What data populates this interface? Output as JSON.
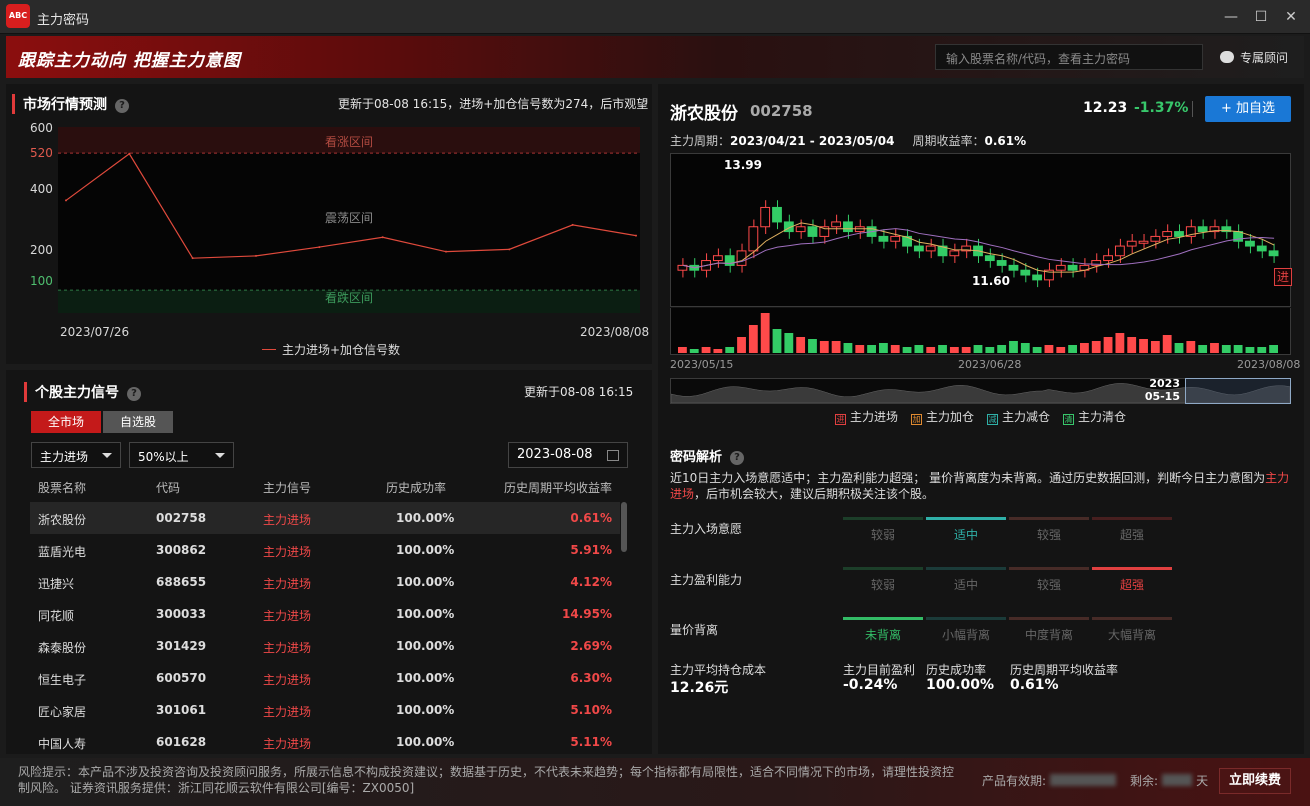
{
  "window": {
    "title": "主力密码",
    "logo_text": "ABC"
  },
  "banner": {
    "slogan": "跟踪主力动向  把握主力意图",
    "search_placeholder": "输入股票名称/代码，查看主力密码",
    "advisor_label": "专属顾问"
  },
  "market": {
    "title": "市场行情预测",
    "note": "更新于08-08 16:15，进场+加仓信号数为274，后市观望",
    "zones": {
      "bull": "看涨区间",
      "neutral": "震荡区间",
      "bear": "看跌区间"
    },
    "legend": "主力进场+加仓信号数",
    "yticks": [
      "600",
      "520",
      "400",
      "200",
      "100"
    ],
    "xticks": [
      "2023/07/26",
      "2023/08/08"
    ]
  },
  "chart_data": {
    "type": "line",
    "series": [
      {
        "name": "主力进场+加仓信号数",
        "values": [
          375,
          518,
          198,
          205,
          232,
          262,
          218,
          225,
          300,
          267
        ]
      }
    ],
    "xlabel_start": "2023/07/26",
    "xlabel_end": "2023/08/08",
    "ylim": [
      30,
      600
    ],
    "thresholds": [
      520,
      100
    ],
    "colors": {
      "line": "#e04a3c",
      "bull_band": "#2a0e0e",
      "bear_band": "#0b1e12"
    }
  },
  "signals": {
    "title": "个股主力信号",
    "note": "更新于08-08 16:15",
    "tabs": [
      "全市场",
      "自选股"
    ],
    "filter_signal": "主力进场",
    "filter_rate": "50%以上",
    "date": "2023-08-08",
    "headers": [
      "股票名称",
      "代码",
      "主力信号",
      "历史成功率",
      "历史周期平均收益率"
    ],
    "rows": [
      {
        "name": "浙农股份",
        "code": "002758",
        "signal": "主力进场",
        "rate": "100.00%",
        "ret": "0.61%"
      },
      {
        "name": "蓝盾光电",
        "code": "300862",
        "signal": "主力进场",
        "rate": "100.00%",
        "ret": "5.91%"
      },
      {
        "name": "迅捷兴",
        "code": "688655",
        "signal": "主力进场",
        "rate": "100.00%",
        "ret": "4.12%"
      },
      {
        "name": "同花顺",
        "code": "300033",
        "signal": "主力进场",
        "rate": "100.00%",
        "ret": "14.95%"
      },
      {
        "name": "森泰股份",
        "code": "301429",
        "signal": "主力进场",
        "rate": "100.00%",
        "ret": "2.69%"
      },
      {
        "name": "恒生电子",
        "code": "600570",
        "signal": "主力进场",
        "rate": "100.00%",
        "ret": "6.30%"
      },
      {
        "name": "匠心家居",
        "code": "301061",
        "signal": "主力进场",
        "rate": "100.00%",
        "ret": "5.10%"
      },
      {
        "name": "中国人寿",
        "code": "601628",
        "signal": "主力进场",
        "rate": "100.00%",
        "ret": "5.11%"
      }
    ]
  },
  "stock": {
    "name": "浙农股份",
    "code": "002758",
    "price": "12.23",
    "change": "-1.37%",
    "add_label": "+ 加自选",
    "period_label": "主力周期：",
    "period": "2023/04/21 - 2023/05/04",
    "period_return_label": "周期收益率：",
    "period_return": "0.61%",
    "high_label": "13.99",
    "low_label": "11.60",
    "entry_marker": "进",
    "kx_labels": [
      "2023/05/15",
      "2023/06/28",
      "2023/08/08"
    ],
    "nav_year": "2023",
    "nav_date": "05-15",
    "legend": [
      {
        "mark": "进",
        "label": "主力进场",
        "color": "#e04040"
      },
      {
        "mark": "加",
        "label": "主力加仓",
        "color": "#e08a30"
      },
      {
        "mark": "减",
        "label": "主力减仓",
        "color": "#2fb0a8"
      },
      {
        "mark": "清",
        "label": "主力清仓",
        "color": "#38c76b"
      }
    ]
  },
  "analysis": {
    "title": "密码解析",
    "text_before": "近10日主力入场意愿适中；主力盈利能力超强；  量价背离度为未背离。通过历史数据回测，判断今日主力意图为",
    "intent": "主力进场",
    "text_after": "，后市机会较大，建议后期积极关注该个股。",
    "metrics": [
      {
        "label": "主力入场意愿",
        "levels": [
          "较弱",
          "适中",
          "较强",
          "超强"
        ],
        "active": 1
      },
      {
        "label": "主力盈利能力",
        "levels": [
          "较弱",
          "适中",
          "较强",
          "超强"
        ],
        "active": 3
      },
      {
        "label": "量价背离",
        "levels": [
          "未背离",
          "小幅背离",
          "中度背离",
          "大幅背离"
        ],
        "active": 0
      }
    ],
    "stats": [
      {
        "label": "主力平均持仓成本",
        "value": "12.26元"
      },
      {
        "label": "主力目前盈利",
        "value": "-0.24%"
      },
      {
        "label": "历史成功率",
        "value": "100.00%"
      },
      {
        "label": "历史周期平均收益率",
        "value": "0.61%"
      }
    ]
  },
  "footer": {
    "disclaimer": "风险提示：本产品不涉及投资咨询及投资顾问服务，所展示信息不构成投资建议；数据基于历史，不代表未来趋势；每个指标都有局限性，适合不同情况下的市场，请理性投资控制风险。 证券资讯服务提供：浙江同花顺云软件有限公司[编号：ZX0050]",
    "expire_label": "产品有效期:",
    "remain_label": "剩余:",
    "day_unit": "天",
    "renew_label": "立即续费"
  }
}
